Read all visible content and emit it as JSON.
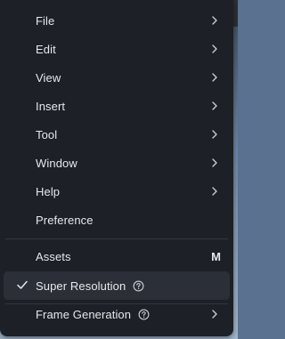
{
  "menu": {
    "items": [
      {
        "label": "File",
        "submenu": true
      },
      {
        "label": "Edit",
        "submenu": true
      },
      {
        "label": "View",
        "submenu": true
      },
      {
        "label": "Insert",
        "submenu": true
      },
      {
        "label": "Tool",
        "submenu": true
      },
      {
        "label": "Window",
        "submenu": true
      },
      {
        "label": "Help",
        "submenu": true
      },
      {
        "label": "Preference",
        "submenu": false
      },
      {
        "label": "Assets",
        "shortcut": "M"
      },
      {
        "label": "Super Resolution",
        "checked": true,
        "help_icon": "question-circle-icon"
      },
      {
        "label": "Frame Generation",
        "submenu": true,
        "help_icon": "question-circle-icon"
      }
    ]
  },
  "icons": {
    "chevron": "chevron-right-icon",
    "check": "checkmark-icon"
  },
  "colors": {
    "menu_background": "#1d2027",
    "selected_background": "#2b2f37",
    "text": "#e6e8ec",
    "separator": "#33373f"
  }
}
